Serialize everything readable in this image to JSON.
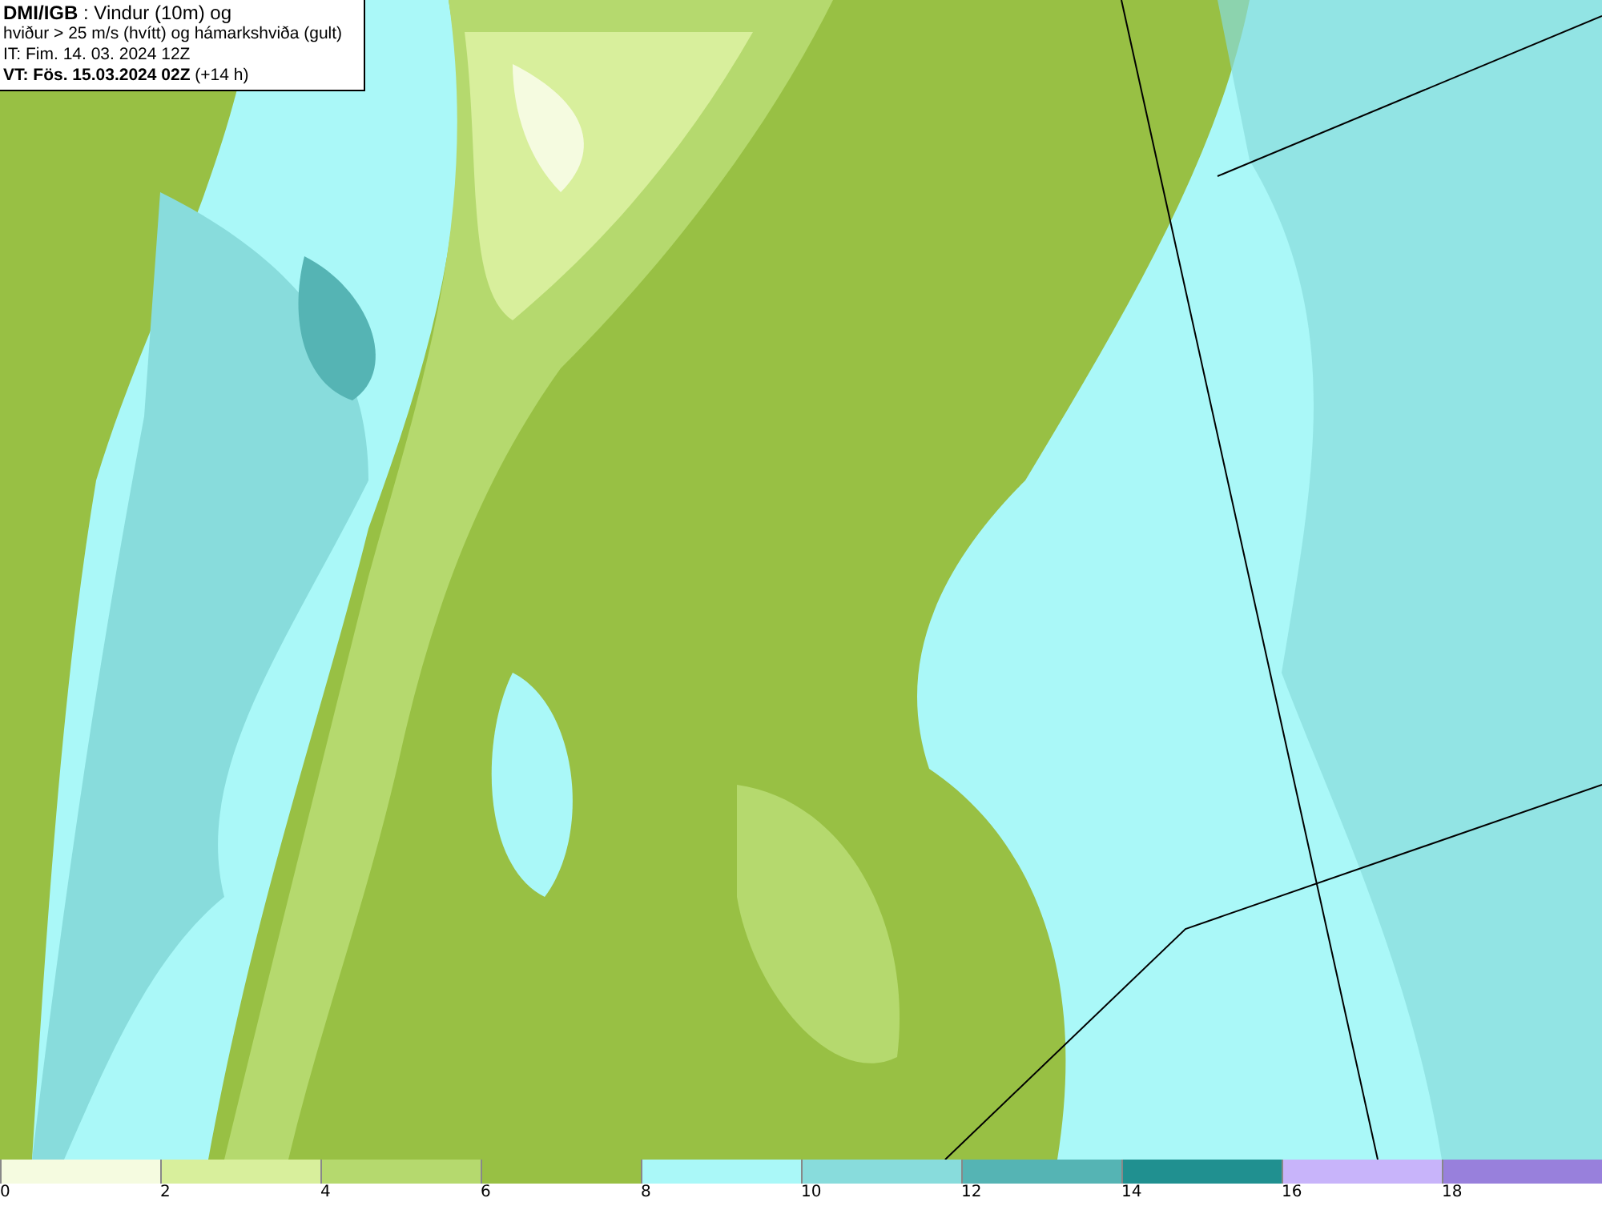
{
  "info_box": {
    "lines": [
      "**DMI/IGB** : Vindur (10m) og",
      "hviður > 25 m/s (hvítt) og hámarkshviða (gult)",
      "IT: Fim. 14. 03. 2024 12Z",
      "**VT: Fös. 15.03.2024 02Z** (+14 h)"
    ]
  },
  "legend": {
    "bins": [
      {
        "label": "0",
        "color": "#f5fbe0"
      },
      {
        "label": "2",
        "color": "#d8ef9c"
      },
      {
        "label": "4",
        "color": "#b5d96e"
      },
      {
        "label": "6",
        "color": "#98c044"
      },
      {
        "label": "8",
        "color": "#aaf8f8"
      },
      {
        "label": "10",
        "color": "#88dcdc"
      },
      {
        "label": "12",
        "color": "#55b4b4"
      },
      {
        "label": "14",
        "color": "#209090"
      },
      {
        "label": "16",
        "color": "#c8b4fa"
      },
      {
        "label": "18",
        "color": "#9880dc"
      }
    ]
  }
}
